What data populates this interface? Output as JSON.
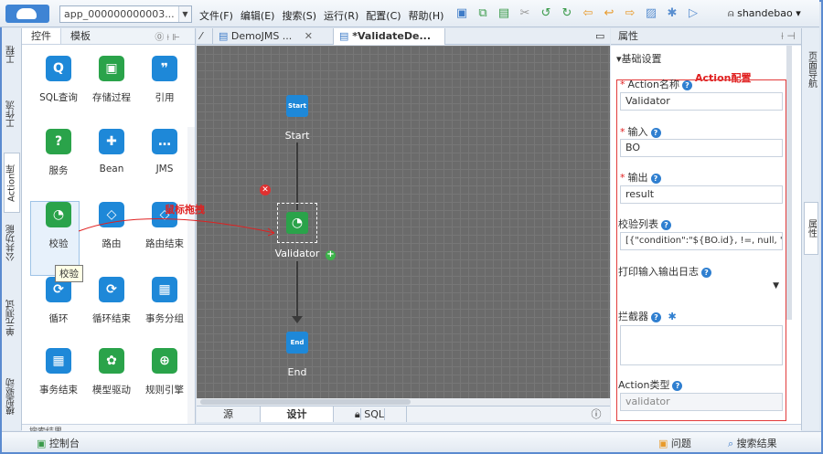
{
  "app_select": "app_000000000003...",
  "menu": [
    "文件(F)",
    "编辑(E)",
    "搜索(S)",
    "运行(R)",
    "配置(C)",
    "帮助(H)"
  ],
  "user": "shandebao",
  "left_vtabs": [
    "工程",
    "工作流",
    "Action库",
    "公共功能",
    "单元测试",
    "模型驱动"
  ],
  "right_vtabs": [
    "页面导航",
    "属性"
  ],
  "palette": {
    "tabs": [
      "控件",
      "模板"
    ],
    "items": [
      {
        "label": "SQL查询",
        "icon": "Q",
        "color": "#1e88d8"
      },
      {
        "label": "存储过程",
        "icon": "▣",
        "color": "#2aa34a"
      },
      {
        "label": "引用",
        "icon": "❞",
        "color": "#1e88d8"
      },
      {
        "label": "服务",
        "icon": "?",
        "color": "#2aa34a"
      },
      {
        "label": "Bean",
        "icon": "✚",
        "color": "#1e88d8"
      },
      {
        "label": "JMS",
        "icon": "…",
        "color": "#1e88d8"
      },
      {
        "label": "校验",
        "icon": "◔",
        "color": "#2aa34a"
      },
      {
        "label": "路由",
        "icon": "◇",
        "color": "#1e88d8"
      },
      {
        "label": "路由结束",
        "icon": "◇",
        "color": "#1e88d8"
      },
      {
        "label": "循环",
        "icon": "⟳",
        "color": "#1e88d8"
      },
      {
        "label": "循环结束",
        "icon": "⟳",
        "color": "#1e88d8"
      },
      {
        "label": "事务分组",
        "icon": "▦",
        "color": "#1e88d8"
      },
      {
        "label": "事务结束",
        "icon": "▦",
        "color": "#1e88d8"
      },
      {
        "label": "模型驱动",
        "icon": "✿",
        "color": "#2aa34a"
      },
      {
        "label": "规则引擎",
        "icon": "⊕",
        "color": "#2aa34a"
      }
    ],
    "tooltip": "校验"
  },
  "doc_tabs": [
    {
      "label": "DemoJMS ...",
      "active": false
    },
    {
      "label": "*ValidateDe...",
      "active": true
    }
  ],
  "canvas": {
    "start_node": "Start",
    "start_label": "Start",
    "validator_label": "Validator",
    "end_node": "End",
    "end_label": "End",
    "drag_note": "鼠标拖拽"
  },
  "bottom_tabs": [
    "源",
    "设计",
    "SQL"
  ],
  "props": {
    "header": "属性",
    "group": "▾基础设置",
    "note": "Action配置",
    "action_name_label": "Action名称",
    "action_name_value": "Validator",
    "input_label": "输入",
    "input_value": "BO",
    "output_label": "输出",
    "output_value": "result",
    "check_list_label": "校验列表",
    "check_list_value": "[{\"condition\":\"${BO.id}, !=, null, \"…",
    "log_label": "打印输入输出日志",
    "interceptor_label": "拦截器",
    "action_type_label": "Action类型",
    "action_type_value": "validator"
  },
  "search_strip": "搜索结果",
  "status": {
    "console": "控制台",
    "problems": "问题",
    "search_results": "搜索结果"
  }
}
